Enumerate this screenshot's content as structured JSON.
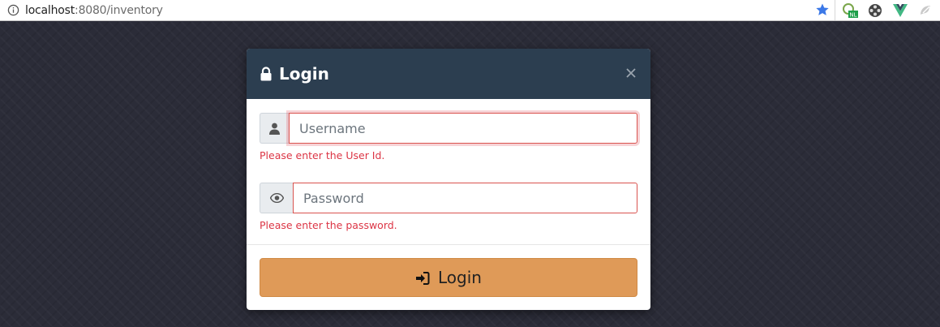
{
  "browser": {
    "url_host": "localhost",
    "url_rest": ":8080/inventory",
    "extensions": [
      "nl-translate-icon",
      "film-reel-icon",
      "vue-devtools-icon",
      "extension-icon"
    ],
    "nl_badge": "NL"
  },
  "modal": {
    "title": "Login",
    "username": {
      "placeholder": "Username",
      "value": "",
      "error": "Please enter the User Id."
    },
    "password": {
      "placeholder": "Password",
      "value": "",
      "error": "Please enter the password."
    },
    "submit_label": "Login"
  },
  "colors": {
    "header": "#2c3e50",
    "button": "#df9a58",
    "error": "#dc3545"
  }
}
